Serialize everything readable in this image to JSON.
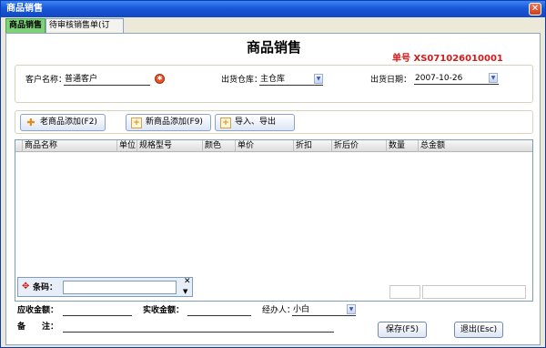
{
  "window": {
    "title": "商品销售",
    "close_glyph": "✕"
  },
  "tabs": [
    {
      "label": "商品销售",
      "active": true
    },
    {
      "label": "待审核销售单(订单)",
      "active": false
    }
  ],
  "header": {
    "title": "商品销售",
    "order_label": "单号",
    "order_number": "XS071026010001"
  },
  "form": {
    "customer_label": "客户名称：",
    "customer_value": "普通客户",
    "customer_icon": "key-icon",
    "warehouse_label": "出货仓库：",
    "warehouse_value": "主仓库",
    "date_label": "出货日期：",
    "date_value": "2007-10-26"
  },
  "toolbar": {
    "add_old_label": "老商品添加(F2)",
    "add_new_label": "新商品添加(F9)",
    "import_export_label": "导入、导出"
  },
  "grid": {
    "columns": [
      "商品名称",
      "单位",
      "规格型号",
      "颜色",
      "单价",
      "折扣",
      "折后价",
      "数量",
      "总金额"
    ],
    "rows": []
  },
  "barcode": {
    "label": "条码：",
    "value": "",
    "close_glyph": "✕",
    "toggle_glyph": "▼"
  },
  "footer": {
    "receivable_label": "应收金额：",
    "receivable_value": "",
    "received_label": "实收金额：",
    "received_value": "",
    "handler_label": "经办人：",
    "handler_value": "小白",
    "remark_label": "备　　注：",
    "remark_value": "",
    "save_label": "保存(F5)",
    "exit_label": "退出(Esc)"
  },
  "colors": {
    "accent_red": "#d21b1b",
    "title_blue": "#1857d8",
    "active_tab_green": "#7ed37a"
  }
}
